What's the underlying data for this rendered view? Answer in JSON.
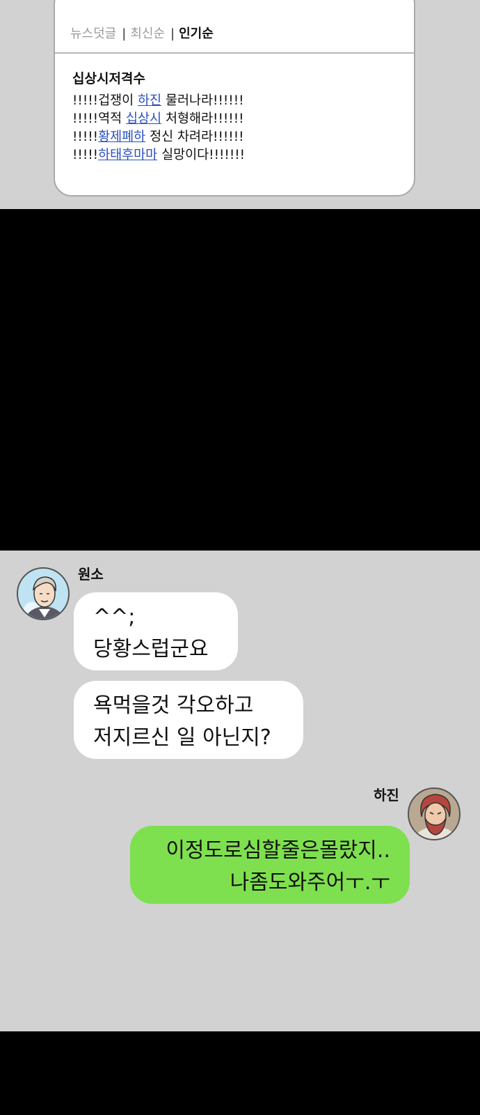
{
  "comment_card": {
    "tabs": {
      "news": "뉴스덧글",
      "latest": "최신순",
      "popular": "인기순"
    },
    "author": "십상시저격수",
    "lines": [
      {
        "pre": "!!!!!겁쟁이 ",
        "link": "하진",
        "post": " 물러나라!!!!!!"
      },
      {
        "pre": "!!!!!역적 ",
        "link": "십상시",
        "post": " 처형해라!!!!!!"
      },
      {
        "pre": "!!!!!",
        "link": "황제폐하",
        "post": " 정신 차려라!!!!!!"
      },
      {
        "pre": "!!!!!",
        "link": "하태후마마",
        "post": " 실망이다!!!!!!!"
      }
    ]
  },
  "chat": {
    "left": {
      "name": "원소",
      "avatar_icon": "male-portrait-avatar",
      "messages": [
        [
          "^^;",
          "당황스럽군요"
        ],
        [
          "욕먹을것 각오하고",
          "저지르신 일 아닌지?"
        ]
      ]
    },
    "right": {
      "name": "하진",
      "avatar_icon": "bearded-man-portrait-avatar",
      "messages": [
        [
          "이정도로심할줄은몰랐지..",
          "나좀도와주어ㅜ.ㅜ"
        ]
      ]
    }
  },
  "colors": {
    "background": "#d2d2d2",
    "gap": "#000000",
    "link": "#2a4fc0",
    "my_bubble": "#7ee04f",
    "their_bubble": "#ffffff"
  }
}
